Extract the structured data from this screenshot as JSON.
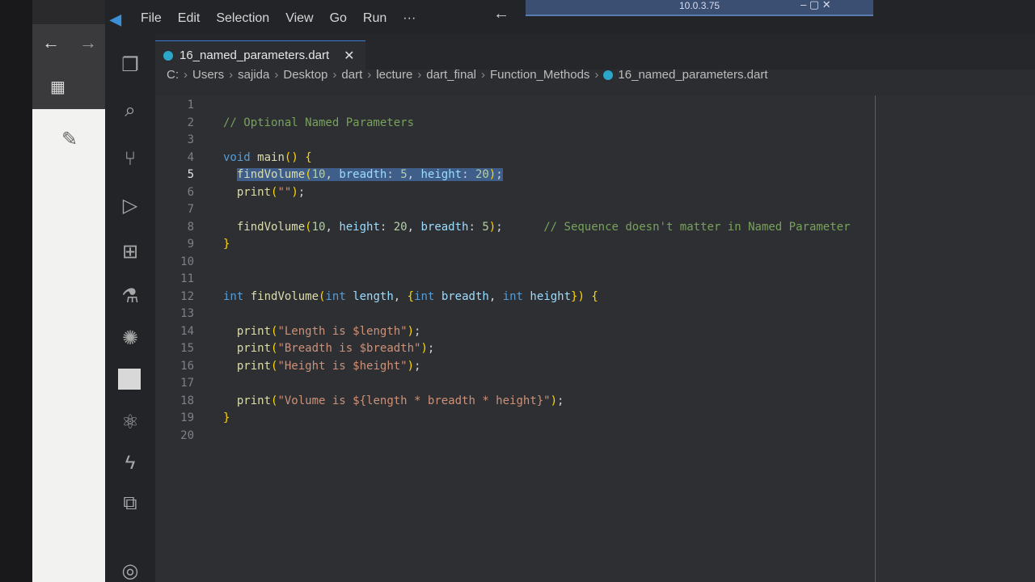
{
  "menu": [
    "File",
    "Edit",
    "Selection",
    "View",
    "Go",
    "Run",
    "···"
  ],
  "remote": {
    "ip": "10.0.3.75",
    "controls": "–  ▢  ✕"
  },
  "tab": {
    "label": "16_named_parameters.dart",
    "close": "✕"
  },
  "breadcrumb": [
    "C:",
    "Users",
    "sajida",
    "Desktop",
    "dart",
    "lecture",
    "dart_final",
    "Function_Methods",
    "16_named_parameters.dart"
  ],
  "activity_icons": [
    "explorer-icon",
    "search-icon",
    "source-control-icon",
    "run-debug-icon",
    "extensions-icon",
    "testing-icon",
    "openai-icon",
    "blank-square-icon",
    "react-icon",
    "lightning-icon",
    "remote-explorer-icon",
    "account-icon"
  ],
  "code_lines": [
    {
      "n": "1",
      "text": ""
    },
    {
      "n": "2",
      "text": "// Optional Named Parameters"
    },
    {
      "n": "3",
      "text": ""
    },
    {
      "n": "4",
      "text": "void main() {"
    },
    {
      "n": "5",
      "text": "  findVolume(10, breadth: 5, height: 20);"
    },
    {
      "n": "6",
      "text": "  print(\"\");"
    },
    {
      "n": "7",
      "text": ""
    },
    {
      "n": "8",
      "text": "  findVolume(10, height: 20, breadth: 5);      // Sequence doesn't matter in Named Parameter"
    },
    {
      "n": "9",
      "text": "}"
    },
    {
      "n": "10",
      "text": ""
    },
    {
      "n": "11",
      "text": ""
    },
    {
      "n": "12",
      "text": "int findVolume(int length, {int breadth, int height}) {"
    },
    {
      "n": "13",
      "text": ""
    },
    {
      "n": "14",
      "text": "  print(\"Length is $length\");"
    },
    {
      "n": "15",
      "text": "  print(\"Breadth is $breadth\");"
    },
    {
      "n": "16",
      "text": "  print(\"Height is $height\");"
    },
    {
      "n": "17",
      "text": ""
    },
    {
      "n": "18",
      "text": "  print(\"Volume is ${length * breadth * height}\");"
    },
    {
      "n": "19",
      "text": "}"
    },
    {
      "n": "20",
      "text": ""
    }
  ]
}
